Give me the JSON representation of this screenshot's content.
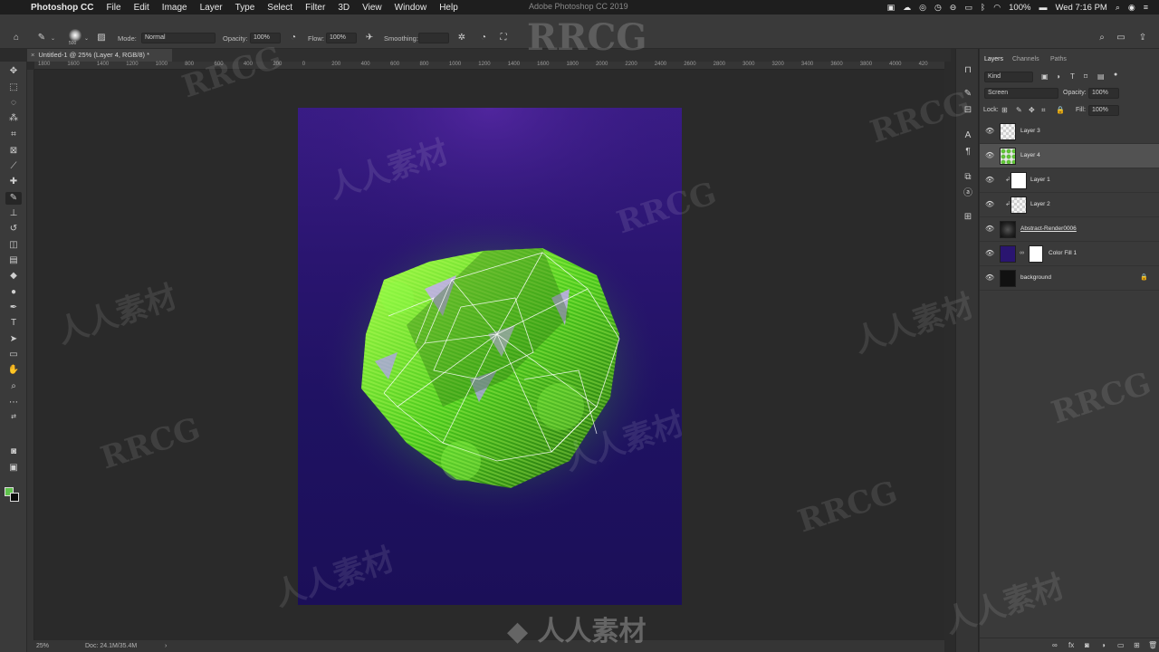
{
  "menubar": {
    "app_name": "Photoshop CC",
    "items": [
      "File",
      "Edit",
      "Image",
      "Layer",
      "Type",
      "Select",
      "Filter",
      "3D",
      "View",
      "Window",
      "Help"
    ],
    "window_title": "Adobe Photoshop CC 2019",
    "battery": "100%",
    "clock": "Wed 7:16 PM"
  },
  "options_bar": {
    "brush_size": "500",
    "mode_label": "Mode:",
    "mode_value": "Normal",
    "opacity_label": "Opacity:",
    "opacity_value": "100%",
    "flow_label": "Flow:",
    "flow_value": "100%",
    "smoothing_label": "Smoothing:"
  },
  "document": {
    "tab_title": "Untitled-1 @ 25% (Layer 4, RGB/8) *",
    "ruler_labels": [
      "1800",
      "1600",
      "1400",
      "1200",
      "1000",
      "800",
      "600",
      "400",
      "200",
      "0",
      "200",
      "400",
      "600",
      "800",
      "1000",
      "1200",
      "1400",
      "1600",
      "1800",
      "2000",
      "2200",
      "2400",
      "2600",
      "2800",
      "3000",
      "3200",
      "3400",
      "3600",
      "3800",
      "4000",
      "420"
    ]
  },
  "statusbar": {
    "zoom": "25%",
    "doc_info": "Doc: 24.1M/35.4M"
  },
  "layers_panel": {
    "tabs": [
      "Layers",
      "Channels",
      "Paths"
    ],
    "active_tab": "Layers",
    "filter_kind": "Kind",
    "blend_mode": "Screen",
    "opacity_label": "Opacity:",
    "opacity_value": "100%",
    "lock_label": "Lock:",
    "fill_label": "Fill:",
    "fill_value": "100%",
    "layers": [
      {
        "name": "Layer 3",
        "thumb": "checker",
        "selected": false,
        "clipped": false,
        "mask": false,
        "locked": false
      },
      {
        "name": "Layer 4",
        "thumb": "green",
        "selected": true,
        "clipped": false,
        "mask": false,
        "locked": false
      },
      {
        "name": "Layer 1",
        "thumb": "white",
        "selected": false,
        "clipped": true,
        "mask": false,
        "locked": false
      },
      {
        "name": "Layer 2",
        "thumb": "checker",
        "selected": false,
        "clipped": true,
        "mask": false,
        "locked": false
      },
      {
        "name": "Abstract-Render0006",
        "thumb": "render",
        "selected": false,
        "clipped": false,
        "mask": false,
        "locked": false
      },
      {
        "name": "Color Fill 1",
        "thumb": "purple",
        "selected": false,
        "clipped": false,
        "mask": true,
        "locked": false
      },
      {
        "name": "background",
        "thumb": "black",
        "selected": false,
        "clipped": false,
        "mask": false,
        "locked": true
      }
    ]
  },
  "colors": {
    "foreground": "#5fc24c",
    "background": "#0a0a0a",
    "canvas_top": "#3a1c86",
    "canvas_bottom": "#1b0f58",
    "glow": "#7cff3a"
  },
  "watermark": {
    "latin": "RRCG",
    "cjk": "人人素材"
  }
}
